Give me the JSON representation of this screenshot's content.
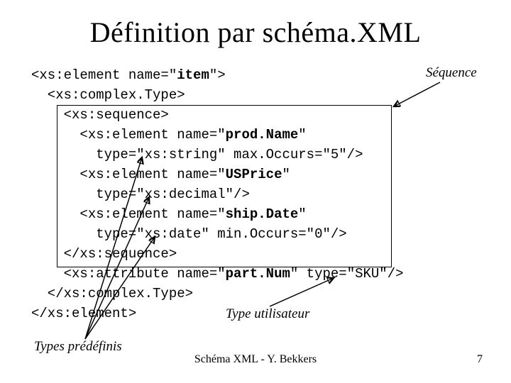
{
  "title": "Définition par schéma.XML",
  "code": {
    "l1a": "<xs:element name=\"",
    "l1b": "item",
    "l1c": "\">",
    "l2": "  <xs:complex.Type>",
    "l3": "    <xs:sequence>",
    "l4a": "      <xs:element name=\"",
    "l4b": "prod.Name",
    "l4c": "\"",
    "l5": "        type=\"xs:string\" max.Occurs=\"5\"/>",
    "l6a": "      <xs:element name=\"",
    "l6b": "USPrice",
    "l6c": "\"",
    "l7": "        type=\"xs:decimal\"/>",
    "l8a": "      <xs:element name=\"",
    "l8b": "ship.Date",
    "l8c": "\"",
    "l9": "        type=\"xs:date\" min.Occurs=\"0\"/>",
    "l10": "    </xs:sequence>",
    "l11a": "    <xs:attribute name=\"",
    "l11b": "part.Num",
    "l11c": "\" type=\"SKU\"/>",
    "l12": "  </xs:complex.Type>",
    "l13": "</xs:element>"
  },
  "annotations": {
    "sequence": "Séquence",
    "type_utilisateur": "Type utilisateur",
    "types_predefinis": "Types prédéfinis"
  },
  "footer": {
    "center": "Schéma XML - Y. Bekkers",
    "page": "7"
  }
}
